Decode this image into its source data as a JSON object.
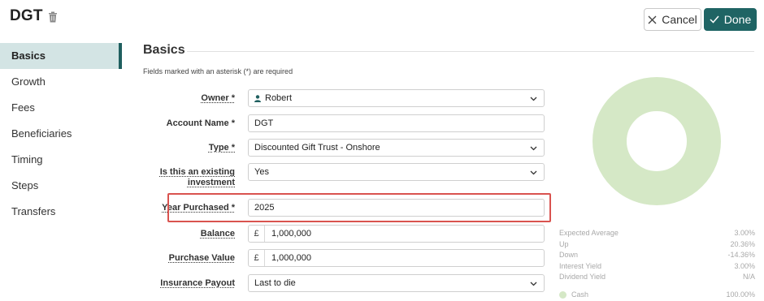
{
  "header": {
    "title": "DGT",
    "cancel_label": "Cancel",
    "done_label": "Done"
  },
  "sidebar": {
    "items": [
      {
        "label": "Basics",
        "active": true
      },
      {
        "label": "Growth"
      },
      {
        "label": "Fees"
      },
      {
        "label": "Beneficiaries"
      },
      {
        "label": "Timing"
      },
      {
        "label": "Steps"
      },
      {
        "label": "Transfers"
      }
    ]
  },
  "form": {
    "section_title": "Basics",
    "required_note": "Fields marked with an asterisk (*) are required",
    "owner": {
      "label": "Owner *",
      "value": "Robert"
    },
    "account_name": {
      "label": "Account Name *",
      "value": "DGT"
    },
    "type": {
      "label": "Type *",
      "value": "Discounted Gift Trust - Onshore"
    },
    "existing": {
      "label_line1": "Is this an existing",
      "label_line2": "investment",
      "value": "Yes"
    },
    "year_purchased": {
      "label": "Year Purchased *",
      "value": "2025"
    },
    "balance": {
      "label": "Balance",
      "currency": "£",
      "value": "1,000,000"
    },
    "purchase_value": {
      "label": "Purchase Value",
      "currency": "£",
      "value": "1,000,000"
    },
    "insurance_payout": {
      "label": "Insurance Payout",
      "value": "Last to die"
    }
  },
  "allocation": {
    "donut_color": "#d5e8c6",
    "stats": [
      {
        "label": "Expected Average",
        "value": "3.00%"
      },
      {
        "label": "Up",
        "value": "20.36%"
      },
      {
        "label": "Down",
        "value": "-14.36%"
      },
      {
        "label": "Interest Yield",
        "value": "3.00%"
      },
      {
        "label": "Dividend Yield",
        "value": "N/A"
      }
    ],
    "legend": [
      {
        "label": "Cash",
        "value": "100.00%"
      }
    ]
  },
  "colors": {
    "accent": "#1f6464",
    "active_bg": "#d3e4e4",
    "highlight": "#d9534f"
  }
}
